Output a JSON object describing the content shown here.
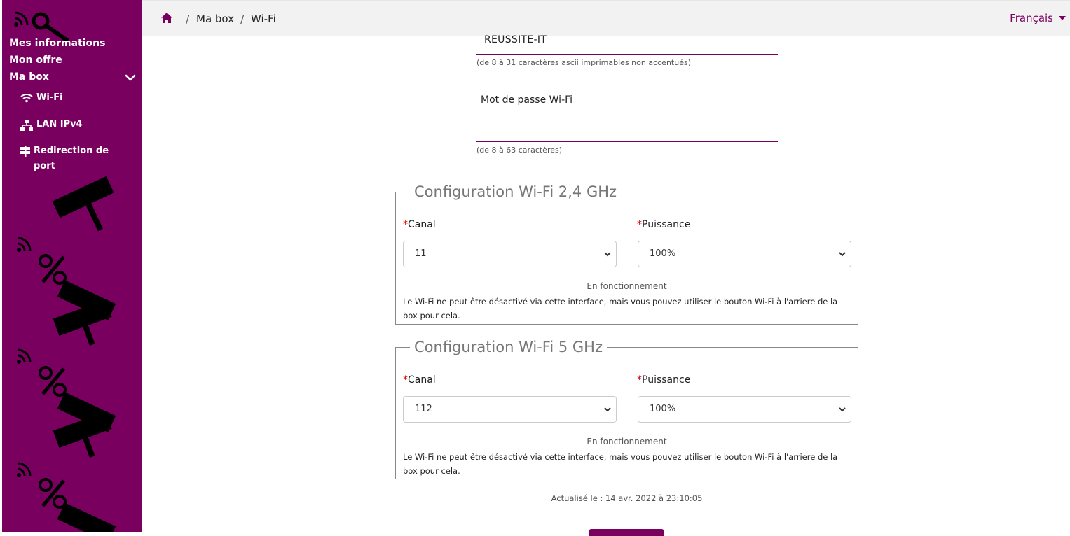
{
  "sidebar": {
    "items": [
      {
        "label": "Mes informations"
      },
      {
        "label": "Mon offre"
      },
      {
        "label": "Ma box"
      }
    ],
    "subitems": [
      {
        "label": "Wi-Fi",
        "icon": "wifi-icon"
      },
      {
        "label": "LAN IPv4",
        "icon": "network-icon"
      },
      {
        "label": "Redirection de port",
        "icon": "signpost-icon"
      }
    ]
  },
  "breadcrumb": {
    "items": [
      "Ma box",
      "Wi-Fi"
    ],
    "separator": "/"
  },
  "language": "Français",
  "ssid": {
    "value": "REUSSITE-IT",
    "hint": "(de 8 à 31 caractères ascii imprimables non accentués)"
  },
  "password": {
    "label": "Mot de passe Wi-Fi",
    "value": "",
    "hint": "(de 8 à 63 caractères)"
  },
  "band24": {
    "legend": "Configuration Wi-Fi 2,4 GHz",
    "channel_label": "Canal",
    "channel_value": "11",
    "power_label": "Puissance",
    "power_value": "100%",
    "status": "En fonctionnement",
    "note": "Le Wi-Fi ne peut être désactivé via cette interface, mais vous pouvez utiliser le bouton Wi-Fi à l'arriere de la box pour cela."
  },
  "band5": {
    "legend": "Configuration Wi-Fi 5 GHz",
    "channel_label": "Canal",
    "channel_value": "112",
    "power_label": "Puissance",
    "power_value": "100%",
    "status": "En fonctionnement",
    "note": "Le Wi-Fi ne peut être désactivé via cette interface, mais vous pouvez utiliser le bouton Wi-Fi à l'arriere de la box pour cela."
  },
  "required_marker": "*",
  "updated": "Actualisé le : 14 avr. 2022 à 23:10:05",
  "colors": {
    "brand": "#7a0060",
    "required": "#d60000"
  }
}
